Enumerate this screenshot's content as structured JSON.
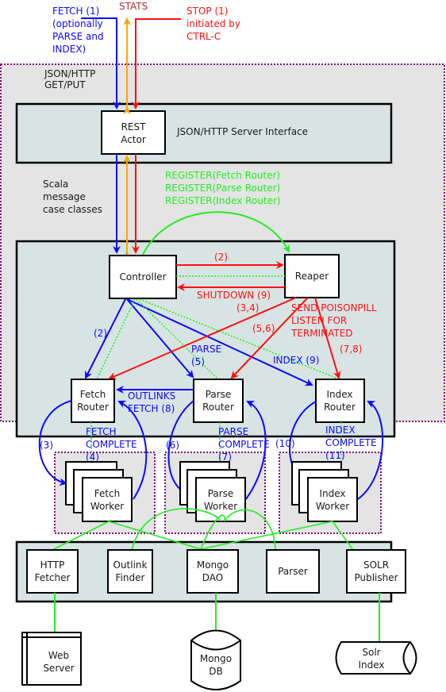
{
  "colors": {
    "blue": "#0a0aff",
    "red": "#ff1010",
    "orange": "#ffa500",
    "green": "#22ee22",
    "stats": "#b03030",
    "purple": "#800080"
  },
  "top_labels": {
    "fetch": [
      "FETCH (1)",
      "(optionally",
      "PARSE and",
      "INDEX)"
    ],
    "stats": "STATS",
    "stop": [
      "STOP (1)",
      "initiated by",
      "CTRL-C"
    ]
  },
  "outer_container": {
    "label": [
      "JSON/HTTP",
      "GET/PUT"
    ]
  },
  "server_panel": {
    "rest_actor": [
      "REST",
      "Actor"
    ],
    "label": "JSON/HTTP Server Interface"
  },
  "scala_label": [
    "Scala",
    "message",
    "case classes"
  ],
  "register_labels": [
    "REGISTER(Fetch Router)",
    "REGISTER(Parse Router)",
    "REGISTER(Index Router)"
  ],
  "actors": {
    "controller": "Controller",
    "reaper": "Reaper",
    "fetch_router": [
      "Fetch",
      "Router"
    ],
    "parse_router": [
      "Parse",
      "Router"
    ],
    "index_router": [
      "Index",
      "Router"
    ],
    "fetch_worker": [
      "Fetch",
      "Worker"
    ],
    "parse_worker": [
      "Parse",
      "Worker"
    ],
    "index_worker": [
      "Index",
      "Worker"
    ]
  },
  "messages": {
    "ctrl_to_reaper": "(2)",
    "shutdown": "SHUTDOWN (9)",
    "m34": "(3,4)",
    "m56": "(5,6)",
    "m78": "(7,8)",
    "poison": [
      "SEND POISONPILL",
      "LISTEN FOR",
      "TERMINATED"
    ],
    "ctrl_fetch": "(2)",
    "parse": [
      "PARSE",
      "(5)"
    ],
    "index": "INDEX (9)",
    "outlinks": [
      "OUTLINKS",
      "FETCH (8)"
    ],
    "fetch_complete": [
      "FETCH",
      "COMPLETE",
      "(4)"
    ],
    "parse_complete": [
      "PARSE",
      "COMPLETE",
      "(7)"
    ],
    "index_complete": [
      "INDEX",
      "COMPLETE",
      "(11)"
    ],
    "m3": "(3)",
    "m6": "(6)",
    "m10": "(10)"
  },
  "services": {
    "http_fetcher": [
      "HTTP",
      "Fetcher"
    ],
    "outlink_finder": [
      "Outlink",
      "Finder"
    ],
    "mongo_dao": [
      "Mongo",
      "DAO"
    ],
    "parser": "Parser",
    "solr_publisher": [
      "SOLR",
      "Publisher"
    ]
  },
  "externals": {
    "web_server": [
      "Web",
      "Server"
    ],
    "mongo_db": [
      "Mongo",
      "DB"
    ],
    "solr_index": [
      "Solr",
      "Index"
    ]
  }
}
